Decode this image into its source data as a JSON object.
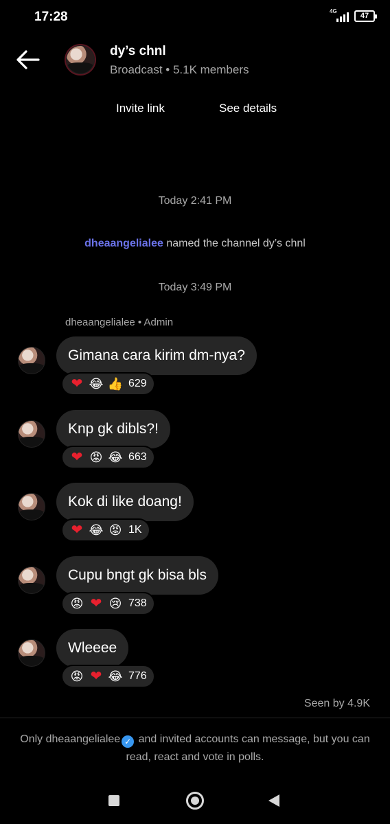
{
  "status_bar": {
    "time": "17:28",
    "network": "4G",
    "battery": "47"
  },
  "header": {
    "back_icon": "arrow-left-icon",
    "channel_name": "dy’s chnl",
    "subtitle": "Broadcast • 5.1K members"
  },
  "actions": {
    "invite_label": "Invite link",
    "details_label": "See details"
  },
  "timeline": {
    "timestamp_1": "Today 2:41 PM",
    "system_user": "dheaangelialee",
    "system_text": " named the channel dy’s chnl",
    "timestamp_2": "Today 3:49 PM",
    "sender": "dheaangelialee • Admin"
  },
  "messages": [
    {
      "text": "Gimana cara kirim dm-nya?",
      "reactions": [
        "❤",
        "😂",
        "👍"
      ],
      "count": "629"
    },
    {
      "text": "Knp gk dibls?!",
      "reactions": [
        "❤",
        "😡",
        "😂"
      ],
      "count": "663"
    },
    {
      "text": "Kok di like doang!",
      "reactions": [
        "❤",
        "😂",
        "😡"
      ],
      "count": "1K"
    },
    {
      "text": "Cupu bngt gk bisa bls",
      "reactions": [
        "😡",
        "❤",
        "😢"
      ],
      "count": "738"
    },
    {
      "text": "Wleeee",
      "reactions": [
        "😡",
        "❤",
        "😂"
      ],
      "count": "776"
    }
  ],
  "seen": "Seen by 4.9K",
  "footer": {
    "prefix": "Only dheaangelialee",
    "verified_icon": "✓",
    "suffix": " and invited accounts can message, but you can read, react and vote in polls."
  },
  "colors": {
    "accent_user": "#6a72e8",
    "bubble": "#262626",
    "verified": "#3897f0"
  }
}
